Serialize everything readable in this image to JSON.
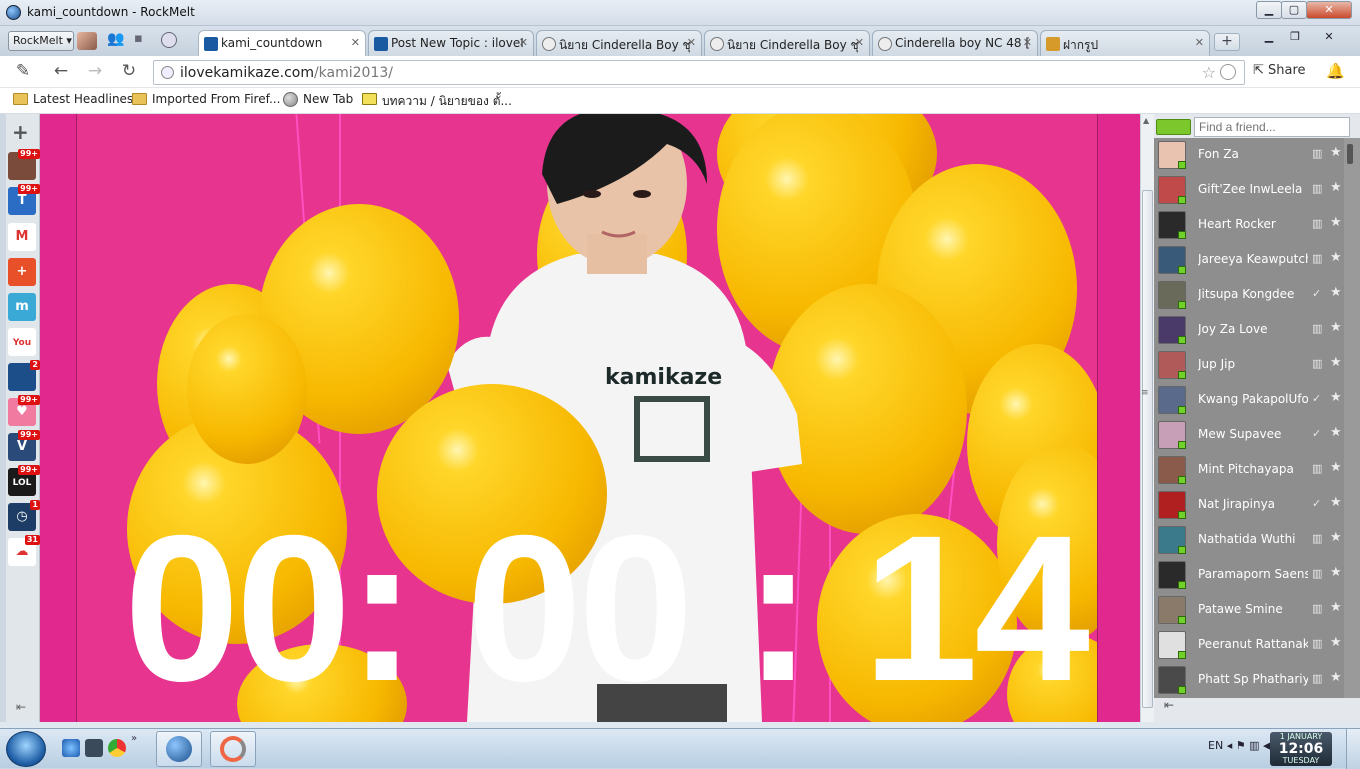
{
  "window": {
    "title": "kami_countdown - RockMelt",
    "minimize": "▁",
    "maximize": "▢",
    "close": "✕"
  },
  "tabbar": {
    "menu_label": "RockMelt ▾",
    "tabs": [
      {
        "label": "kami_countdown",
        "active": true,
        "favicon_color": "#1a5aa0"
      },
      {
        "label": "Post New Topic : iloveI",
        "active": false,
        "favicon_color": "#1a5aa0"
      },
      {
        "label": "นิยาย Cinderella Boy ชุ",
        "active": false,
        "favicon_color": "#888888"
      },
      {
        "label": "นิยาย Cinderella Boy ชุ",
        "active": false,
        "favicon_color": "#888888"
      },
      {
        "label": "Cinderella boy NC 48 [",
        "active": false,
        "favicon_color": "#888888"
      },
      {
        "label": "ฝากรูป",
        "active": false,
        "favicon_color": "#d69a2a"
      }
    ],
    "close_glyph": "✕",
    "new_tab": "+"
  },
  "toolbar": {
    "url_domain": "ilovekamikaze.com",
    "url_path": "/kami2013/",
    "share_label": "Share"
  },
  "bookmarks": [
    {
      "label": "Latest Headlines",
      "type": "folder"
    },
    {
      "label": "Imported From Firef...",
      "type": "folder"
    },
    {
      "label": "New Tab",
      "type": "globe"
    },
    {
      "label": "บทความ / นิยายของ ตั้...",
      "type": "site"
    }
  ],
  "apps": [
    {
      "icon": "photo-app-icon",
      "badge": "99+",
      "color": "#7a4b3a",
      "glyph": ""
    },
    {
      "icon": "t-app-icon",
      "badge": "99+",
      "color": "#2b6cc4",
      "glyph": "T"
    },
    {
      "icon": "gmail-icon",
      "badge": "",
      "color": "#ffffff",
      "glyph": "M"
    },
    {
      "icon": "plus-app-icon",
      "badge": "",
      "color": "#e8502a",
      "glyph": "+"
    },
    {
      "icon": "m-app-icon",
      "badge": "",
      "color": "#3aa9d6",
      "glyph": "m"
    },
    {
      "icon": "youtube-icon",
      "badge": "",
      "color": "#ffffff",
      "glyph": "You"
    },
    {
      "icon": "globe-app-icon",
      "badge": "2",
      "color": "#1c4f8a",
      "glyph": ""
    },
    {
      "icon": "heart-app-icon",
      "badge": "99+",
      "color": "#f07aa0",
      "glyph": "♥"
    },
    {
      "icon": "shield-app-icon",
      "badge": "99+",
      "color": "#2a4a7a",
      "glyph": "V"
    },
    {
      "icon": "lol-app-icon",
      "badge": "99+",
      "color": "#1a1a1a",
      "glyph": "LOL"
    },
    {
      "icon": "clock-app-icon",
      "badge": "1",
      "color": "#1e3d66",
      "glyph": "◷"
    },
    {
      "icon": "chat-app-icon",
      "badge": "31",
      "color": "#ffffff",
      "glyph": "☁"
    }
  ],
  "page": {
    "countdown": "00: 00 : 14",
    "shirt_brand": "kamikaze"
  },
  "friends": {
    "search_placeholder": "Find a friend...",
    "list": [
      {
        "name": "Fon Za",
        "gift": "▥",
        "mark": "★",
        "avatar": "#e9c2b0"
      },
      {
        "name": "Gift'Zee InwLeela",
        "gift": "▥",
        "mark": "★",
        "avatar": "#c04a4a"
      },
      {
        "name": "Heart Rocker",
        "gift": "▥",
        "mark": "★",
        "avatar": "#2a2a2a"
      },
      {
        "name": "Jareeya Keawputch...",
        "gift": "▥",
        "mark": "★",
        "avatar": "#3a5a7a"
      },
      {
        "name": "Jitsupa Kongdee",
        "gift": "✓",
        "mark": "★",
        "avatar": "#6a6a5a"
      },
      {
        "name": "Joy Za Love",
        "gift": "▥",
        "mark": "★",
        "avatar": "#4a3a6a"
      },
      {
        "name": "Jup Jip",
        "gift": "▥",
        "mark": "★",
        "avatar": "#b05a5a"
      },
      {
        "name": "Kwang PakapolUfo...",
        "gift": "✓",
        "mark": "★",
        "avatar": "#5a6a8a"
      },
      {
        "name": "Mew Supavee",
        "gift": "✓",
        "mark": "★",
        "avatar": "#c7a0b8"
      },
      {
        "name": "Mint Pitchayapa",
        "gift": "▥",
        "mark": "★",
        "avatar": "#8a5a4a"
      },
      {
        "name": "Nat Jirapinya",
        "gift": "✓",
        "mark": "★",
        "avatar": "#b02020"
      },
      {
        "name": "Nathatida Wuthi",
        "gift": "▥",
        "mark": "★",
        "avatar": "#3a7a8a"
      },
      {
        "name": "Paramaporn Saens...",
        "gift": "▥",
        "mark": "★",
        "avatar": "#2a2a2a"
      },
      {
        "name": "Patawe Smine",
        "gift": "▥",
        "mark": "★",
        "avatar": "#8a7a6a"
      },
      {
        "name": "Peeranut Rattanak...",
        "gift": "▥",
        "mark": "★",
        "avatar": "#e0e0e0"
      },
      {
        "name": "Phatt Sp Phathariya",
        "gift": "▥",
        "mark": "★",
        "avatar": "#4a4a4a"
      }
    ]
  },
  "taskbar": {
    "lang": "EN",
    "date_top": "1 JANUARY",
    "time": "12:06",
    "day": "TUESDAY"
  }
}
